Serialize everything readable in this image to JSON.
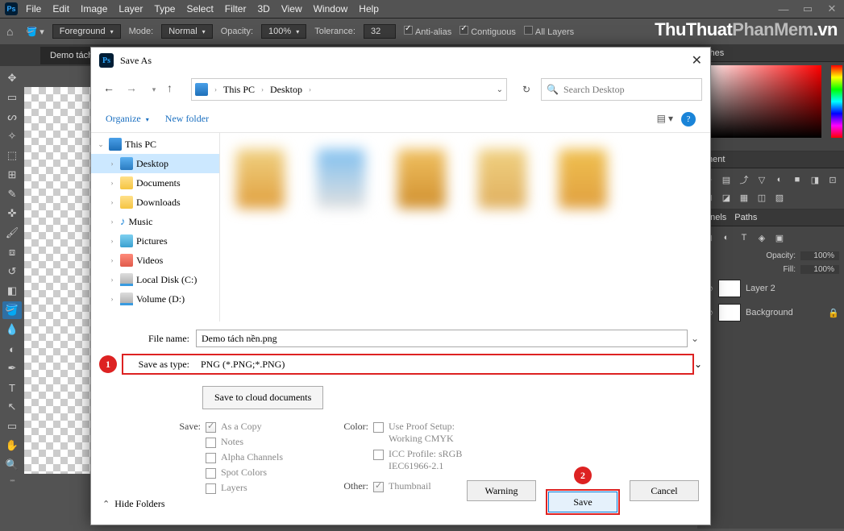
{
  "menubar": [
    "File",
    "Edit",
    "Image",
    "Layer",
    "Type",
    "Select",
    "Filter",
    "3D",
    "View",
    "Window",
    "Help"
  ],
  "optbar": {
    "fg": "Foreground",
    "mode_lbl": "Mode:",
    "mode": "Normal",
    "opacity_lbl": "Opacity:",
    "opacity": "100%",
    "tol_lbl": "Tolerance:",
    "tol": "32",
    "aa": "Anti-alias",
    "contig": "Contiguous",
    "all": "All Layers"
  },
  "doc_tab": "Demo tách",
  "watermark": {
    "a": "ThuThuat",
    "b": "PhanMem",
    "c": ".vn"
  },
  "right": {
    "tab_swatches": "ches",
    "tab_adj": "ment",
    "tab_channels": "nnels",
    "tab_paths": "Paths",
    "opacity_lbl": "Opacity:",
    "opacity": "100%",
    "fill_lbl": "Fill:",
    "fill": "100%",
    "layer2": "Layer 2",
    "layer_bg": "Background"
  },
  "dialog": {
    "title": "Save As",
    "crumbs": [
      "This PC",
      "Desktop"
    ],
    "search_ph": "Search Desktop",
    "organize": "Organize",
    "new_folder": "New folder",
    "tree": {
      "this_pc": "This PC",
      "desktop": "Desktop",
      "documents": "Documents",
      "downloads": "Downloads",
      "music": "Music",
      "pictures": "Pictures",
      "videos": "Videos",
      "disk_c": "Local Disk (C:)",
      "disk_d": "Volume (D:)"
    },
    "file_name_lbl": "File name:",
    "file_name": "Demo tách nền.png",
    "save_type_lbl": "Save as type:",
    "save_type": "PNG (*.PNG;*.PNG)",
    "cloud_btn": "Save to cloud documents",
    "save_lbl": "Save:",
    "as_copy": "As a Copy",
    "notes": "Notes",
    "alpha": "Alpha Channels",
    "spot": "Spot Colors",
    "layers": "Layers",
    "color_lbl": "Color:",
    "proof": "Use Proof Setup:",
    "proof2": "Working CMYK",
    "icc": "ICC Profile:  sRGB",
    "icc2": "IEC61966-2.1",
    "other_lbl": "Other:",
    "thumb": "Thumbnail",
    "badge1": "1",
    "badge2": "2",
    "warning": "Warning",
    "save": "Save",
    "cancel": "Cancel",
    "hide_folders": "Hide Folders"
  }
}
